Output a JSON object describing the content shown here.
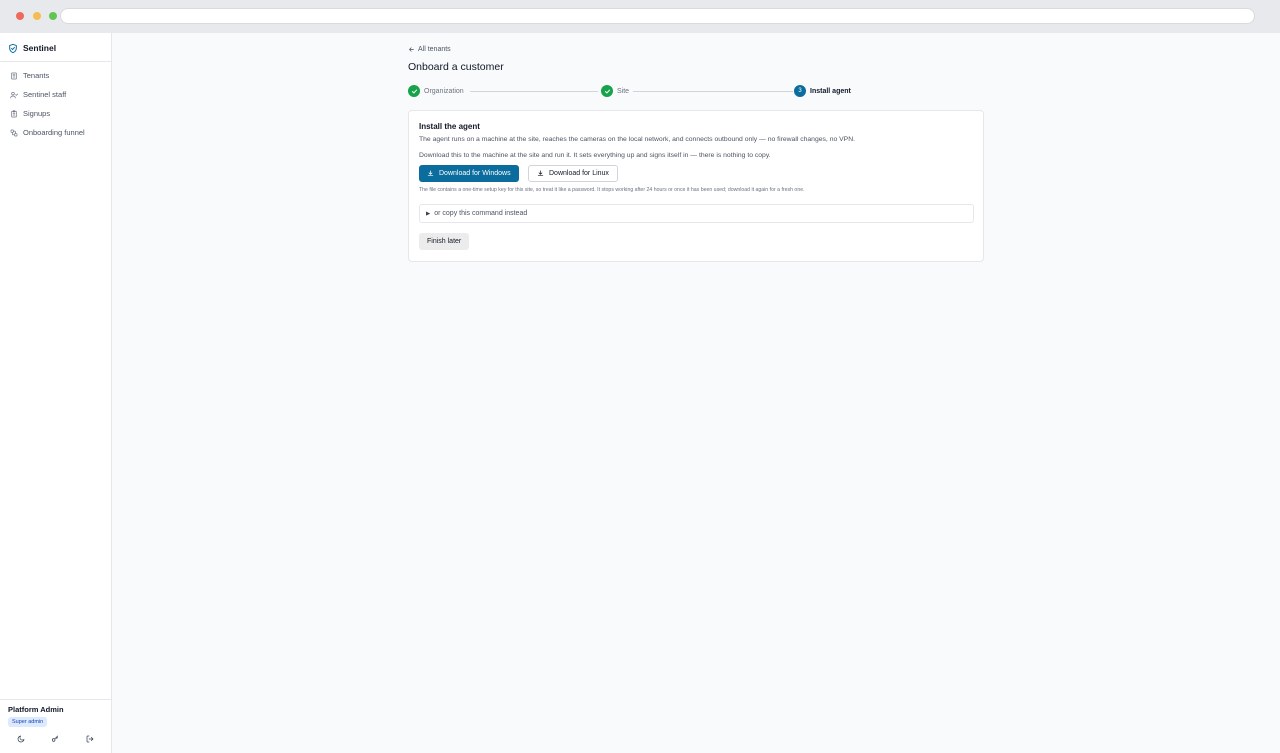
{
  "app": {
    "brand": "Sentinel"
  },
  "sidebar": {
    "items": [
      {
        "label": "Tenants",
        "icon": "building-icon"
      },
      {
        "label": "Sentinel staff",
        "icon": "users-icon"
      },
      {
        "label": "Signups",
        "icon": "clipboard-icon"
      },
      {
        "label": "Onboarding funnel",
        "icon": "workflow-icon"
      }
    ],
    "user": {
      "name": "Platform Admin",
      "role": "Super admin"
    },
    "footer_icons": [
      "moon-icon",
      "key-icon",
      "logout-icon"
    ]
  },
  "main": {
    "back_link": "All tenants",
    "title": "Onboard a customer",
    "steps": [
      {
        "label": "Organization",
        "state": "done"
      },
      {
        "label": "Site",
        "state": "done"
      },
      {
        "label": "Install agent",
        "state": "active",
        "number": "3"
      }
    ],
    "card": {
      "title": "Install the agent",
      "description": "The agent runs on a machine at the site, reaches the cameras on the local network, and connects outbound only — no firewall changes, no VPN.",
      "instruction": "Download this to the machine at the site and run it. It sets everything up and signs itself in — there is nothing to copy.",
      "download_windows": "Download for Windows",
      "download_linux": "Download for Linux",
      "fine_print": "The file contains a one-time setup key for this site, so treat it like a password. It stops working after 24 hours or once it has been used; download it again for a fresh one.",
      "copy_command": "or copy this command instead",
      "finish_later": "Finish later"
    }
  },
  "colors": {
    "accent": "#0b6d9e",
    "success": "#16a34a",
    "badge_bg": "#dbeafe"
  }
}
